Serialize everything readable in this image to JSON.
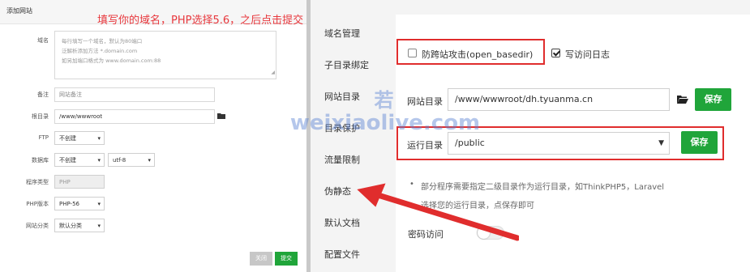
{
  "left_dialog": {
    "title": "添加网站",
    "annotation": "填写你的域名，PHP选择5.6，之后点击提交",
    "labels": {
      "domain": "域名",
      "remark": "备注",
      "root": "根目录",
      "ftp": "FTP",
      "database": "数据库",
      "program_type": "程序类型",
      "php_version": "PHP版本",
      "site_category": "网站分类"
    },
    "domain_placeholder_lines": [
      "每行填写一个域名，默认为80端口",
      "泛解析添加方法 *.domain.com",
      "如另加端口格式为 www.domain.com:88"
    ],
    "remark_placeholder": "网站备注",
    "root_value": "/www/wwwroot",
    "ftp_value": "不创建",
    "database_value": "不创建",
    "charset_value": "utf-8",
    "program_type_value": "PHP",
    "php_version_value": "PHP-56",
    "site_category_value": "默认分类",
    "close_label": "关闭",
    "submit_label": "提交"
  },
  "right_panel": {
    "sidebar_items": [
      "域名管理",
      "子目录绑定",
      "网站目录",
      "目录保护",
      "流量限制",
      "伪静态",
      "默认文档",
      "配置文件"
    ],
    "anti_xss_label": "防跨站攻击(open_basedir)",
    "anti_xss_checked": false,
    "access_log_label": "写访问日志",
    "access_log_checked": true,
    "site_dir_label": "网站目录",
    "site_dir_value": "/www/wwwroot/dh.tyuanma.cn",
    "run_dir_label": "运行目录",
    "run_dir_value": "/public",
    "save_label": "保存",
    "note_line1": "部分程序需要指定二级目录作为运行目录，如ThinkPHP5，Laravel",
    "note_line2": "选择您的运行目录，点保存即可",
    "password_access_label": "密码访问",
    "password_access_on": false
  },
  "watermark": {
    "line1": "若",
    "line2": "weixiaolive.com"
  },
  "colors": {
    "accent_green": "#20a53a",
    "highlight_red": "#e02d2d"
  }
}
